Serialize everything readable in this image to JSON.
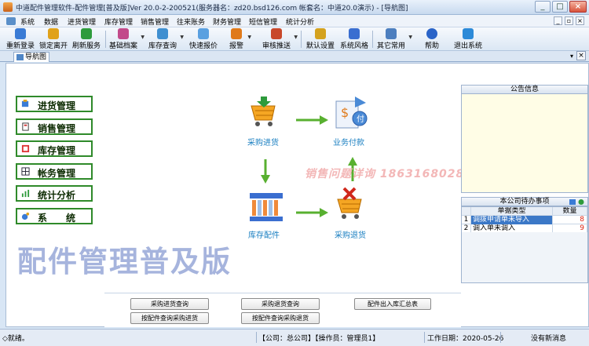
{
  "window": {
    "title": "中道配件管理软件-配件管理[普及版]Ver 20.0-2-200521(服务器名：zd20.bsd126.com 帐套名：中道20.0演示) - [导航图]",
    "controls": {
      "minimize": "_",
      "maximize": "□",
      "close": "×"
    }
  },
  "menu": {
    "items": [
      "系统",
      "数据",
      "进货管理",
      "库存管理",
      "销售管理",
      "往来账务",
      "财务管理",
      "短信管理",
      "统计分析"
    ],
    "mdi_controls": {
      "minimize": "_",
      "restore": "▫",
      "close": "×"
    }
  },
  "toolbar": {
    "buttons": [
      {
        "label": "重新登录",
        "icon": "relogin-icon",
        "color": "#3a7bd5"
      },
      {
        "label": "锁定离开",
        "icon": "lock-icon",
        "color": "#e0a21a"
      },
      {
        "label": "刷新服务",
        "icon": "refresh-icon",
        "color": "#2e9b3c"
      },
      {
        "label": "基础档案",
        "icon": "archive-icon",
        "color": "#c24a8a"
      },
      {
        "label": "库存查询",
        "icon": "stock-query-icon",
        "color": "#3f8fd0"
      },
      {
        "label": "快速报价",
        "icon": "quote-icon",
        "color": "#5aa0e0"
      },
      {
        "label": "报警",
        "icon": "alarm-icon",
        "color": "#e07a1a"
      },
      {
        "label": "审核推送",
        "icon": "review-icon",
        "color": "#c8482a"
      },
      {
        "label": "默认设置",
        "icon": "settings-icon",
        "color": "#d4a21e"
      },
      {
        "label": "系统风格",
        "icon": "style-icon",
        "color": "#3a6ed0"
      },
      {
        "label": "其它常用",
        "icon": "other-icon",
        "color": "#4d7fbf"
      },
      {
        "label": "帮助",
        "icon": "help-icon",
        "color": "#2a64c8"
      },
      {
        "label": "退出系统",
        "icon": "exit-icon",
        "color": "#2c8ad8"
      }
    ]
  },
  "tab": {
    "label": "导航图",
    "close": "▾",
    "x": "×"
  },
  "nav": {
    "buttons": [
      "进货管理",
      "销售管理",
      "库存管理",
      "帐务管理",
      "统计分析",
      "系　　统"
    ]
  },
  "flow": {
    "purchase": "采购进货",
    "payment": "业务付款",
    "stock": "库存配件",
    "return": "采购退货"
  },
  "watermark": "销售问题详询  18631680283",
  "edition_title": "配件管理普及版",
  "notice": {
    "title": "公告信息"
  },
  "todo": {
    "title": "本公司待办事项",
    "columns": [
      "单据类型",
      "数量"
    ],
    "rows": [
      {
        "index": "1",
        "name": "调拨申请单未导入",
        "count": "8"
      },
      {
        "index": "2",
        "name": "调入单未调入",
        "count": "9"
      }
    ]
  },
  "quick_buttons": [
    "采购进货查询",
    "采购退货查询",
    "配件出入库汇总表",
    "按配件查询采购进货",
    "按配件查询采购退货"
  ],
  "status": {
    "ready": "◇就绪。",
    "company": "【公司：总公司】【操作员：管理员1】",
    "workdate": "工作日期：2020-05-26",
    "message": "没有新消息"
  },
  "colors": {
    "accent": "#2f8a2a",
    "bigtitle": "#a6b4dd",
    "watermark": "#f3b7b7",
    "flowlabel": "#1a7fc1"
  }
}
